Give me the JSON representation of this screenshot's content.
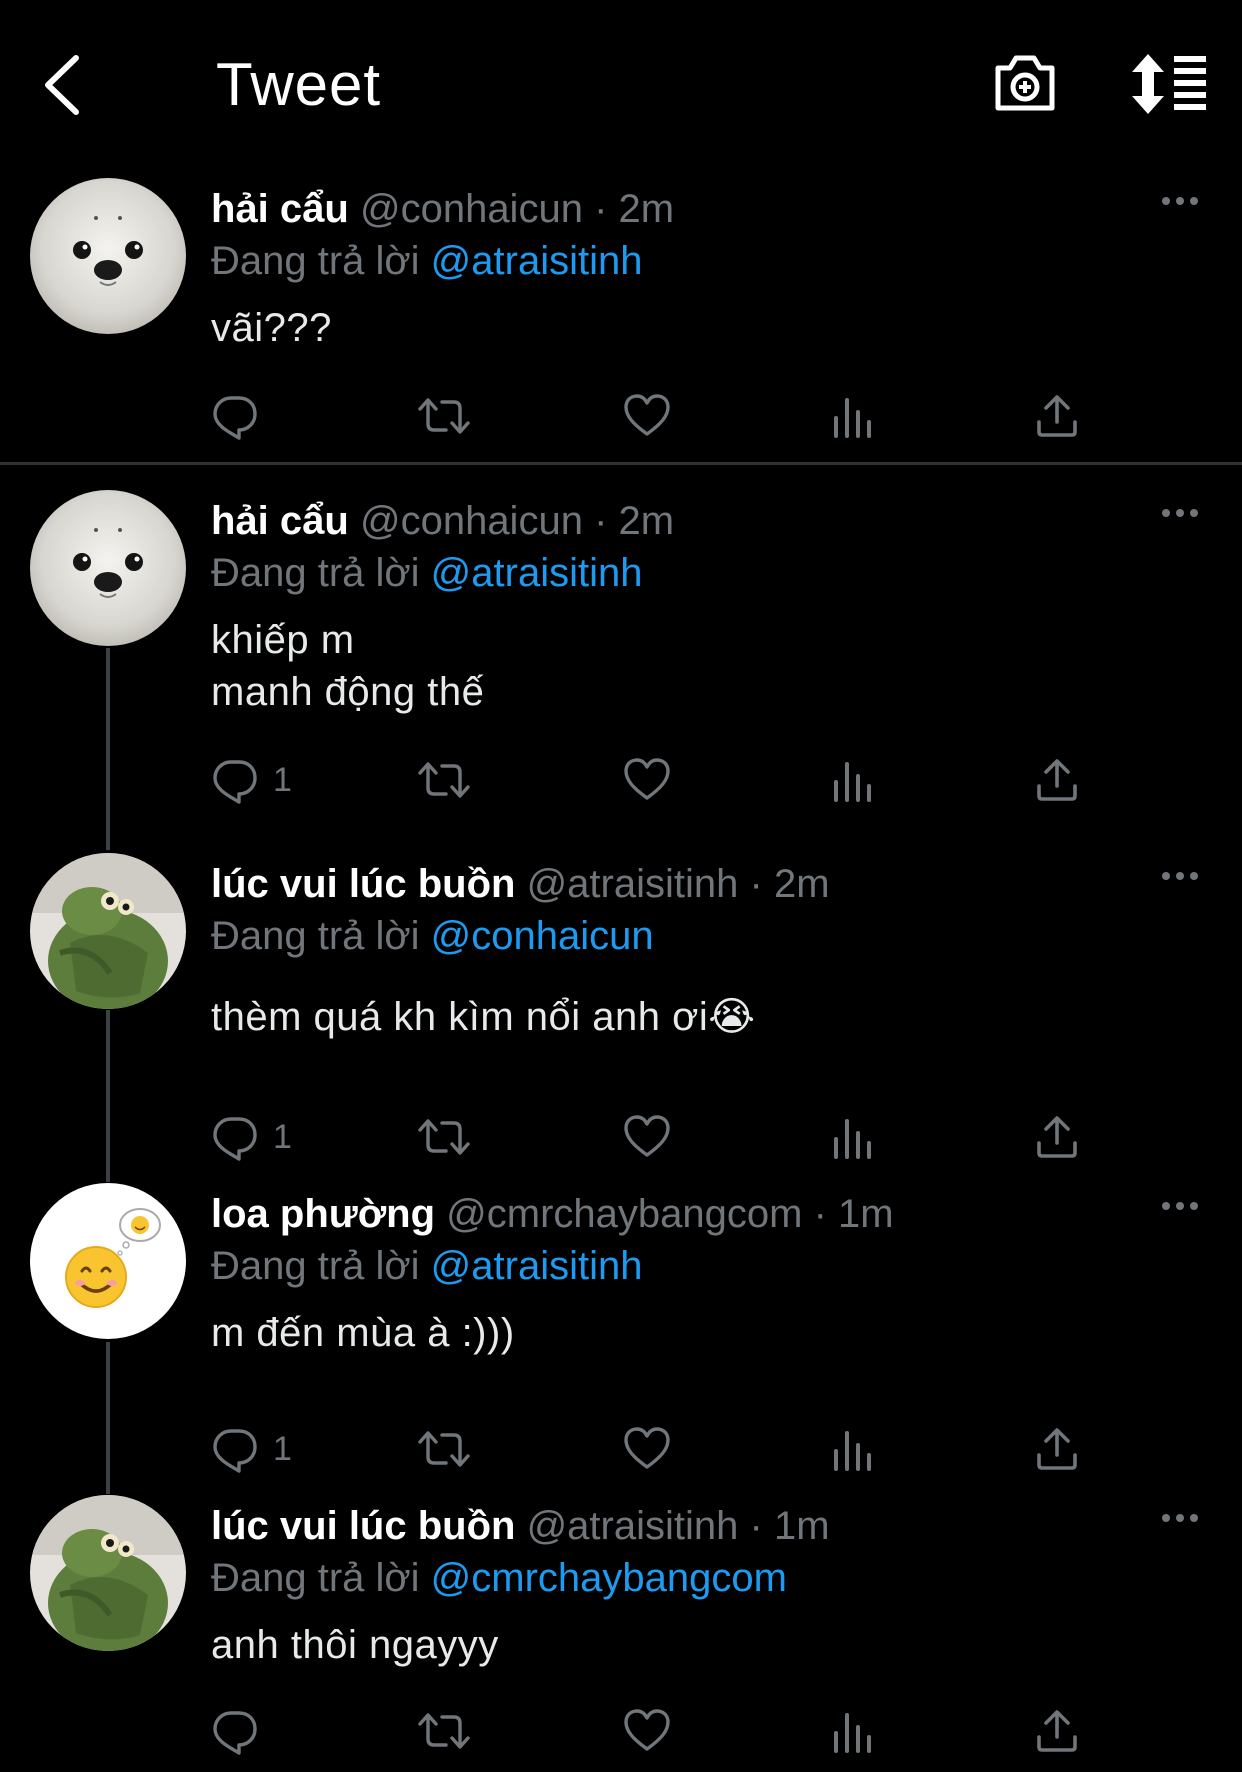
{
  "header": {
    "title": "Tweet"
  },
  "icons": {
    "back": "chevron-left-icon",
    "camera": "camera-icon",
    "sort": "sort-icon",
    "more": "more-icon",
    "reply": "reply-icon",
    "retweet": "retweet-icon",
    "like": "like-icon",
    "views": "views-icon",
    "share": "share-icon"
  },
  "colors": {
    "background": "#000000",
    "accent": "#1d9bf0",
    "secondary_text": "#71767b"
  },
  "tweets": [
    {
      "name": "hải cẩu",
      "handle": "@conhaicun",
      "dot": "·",
      "time": "2m",
      "reply_label": "Đang trả lời",
      "reply_to": "@atraisitinh",
      "text": "vãi???",
      "reply_count": ""
    },
    {
      "name": "hải cẩu",
      "handle": "@conhaicun",
      "dot": "·",
      "time": "2m",
      "reply_label": "Đang trả lời",
      "reply_to": "@atraisitinh",
      "text": "khiếp m\nmanh động thế",
      "reply_count": "1"
    },
    {
      "name": "lúc vui lúc buồn",
      "handle": "@atraisitinh",
      "dot": "·",
      "time": "2m",
      "reply_label": "Đang trả lời",
      "reply_to": "@conhaicun",
      "text": "thèm quá kh kìm nổi anh ơi😭",
      "reply_count": "1"
    },
    {
      "name": "loa phường",
      "handle": "@cmrchaybangcom",
      "dot": "·",
      "time": "1m",
      "reply_label": "Đang trả lời",
      "reply_to": "@atraisitinh",
      "text": "m đến mùa à :)))",
      "reply_count": "1"
    },
    {
      "name": "lúc vui lúc buồn",
      "handle": "@atraisitinh",
      "dot": "·",
      "time": "1m",
      "reply_label": "Đang trả lời",
      "reply_to": "@cmrchaybangcom",
      "text": "anh thôi ngayyy",
      "reply_count": ""
    }
  ]
}
